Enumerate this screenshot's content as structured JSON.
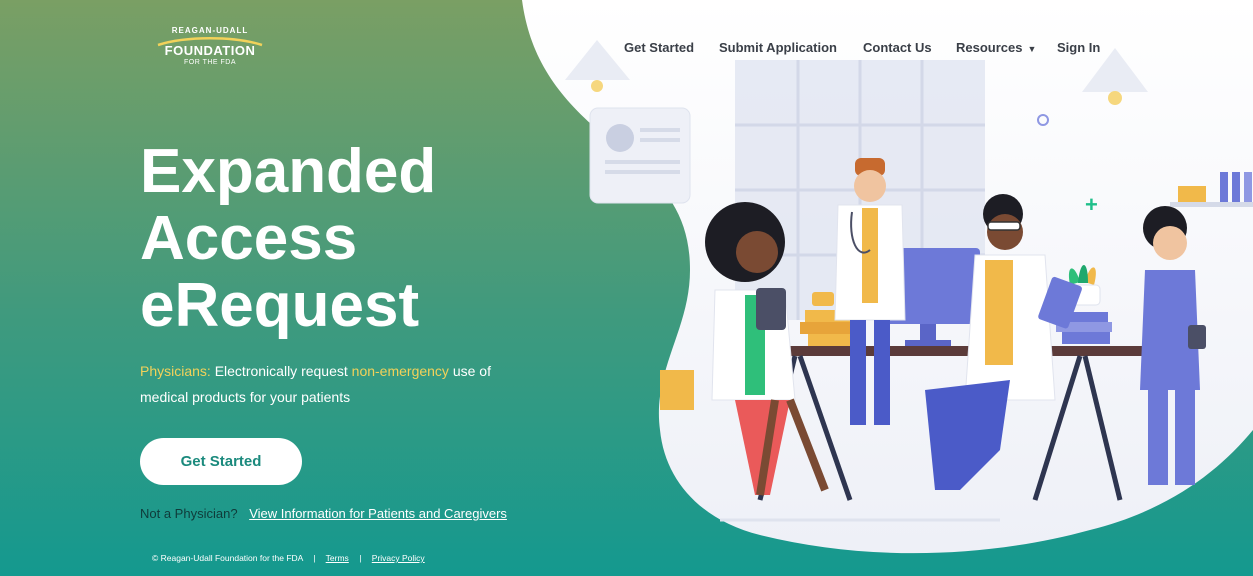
{
  "logo": {
    "top_text": "REAGAN-UDALL",
    "main_text": "FOUNDATION",
    "sub_text": "FOR THE FDA"
  },
  "nav": {
    "items": [
      {
        "label": "Get Started"
      },
      {
        "label": "Submit Application"
      },
      {
        "label": "Contact Us"
      },
      {
        "label": "Resources"
      },
      {
        "label": "Sign In"
      }
    ]
  },
  "hero": {
    "title_lines": [
      "Expanded",
      "Access",
      "eRequest"
    ],
    "lead": {
      "physicians": "Physicians:",
      "part1": " Electronically request ",
      "non_emergency": "non-emergency",
      "part2": " use of medical products for your patients"
    },
    "cta_label": "Get Started",
    "not_physician": "Not a Physician?",
    "patients_link": "View Information for Patients and Caregivers"
  },
  "footer": {
    "copyright": "© Reagan-Udall Foundation for the FDA",
    "separator": "|",
    "terms": "Terms",
    "privacy": "Privacy Policy"
  },
  "colors": {
    "gradient_top": "#7a9f64",
    "gradient_bottom": "#16998f",
    "highlight": "#f2d25a",
    "nav_text": "#3a3f47"
  },
  "icons": [
    "caret-down-icon",
    "plus-icon"
  ]
}
